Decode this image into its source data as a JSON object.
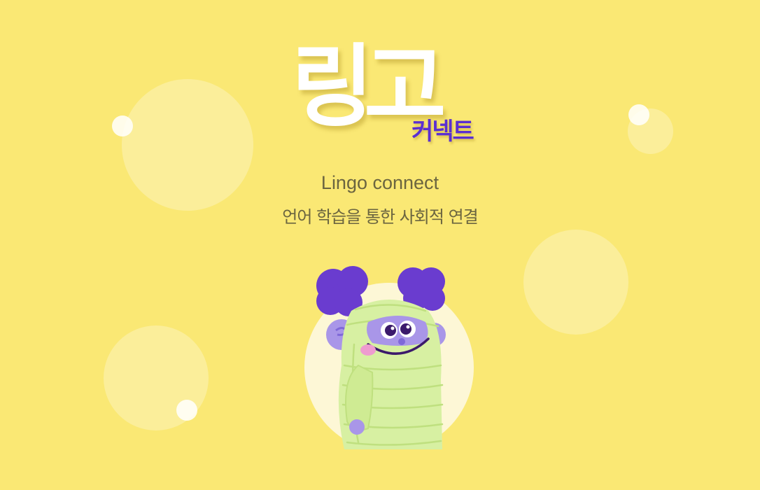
{
  "logo": {
    "main": "링고",
    "sub": "커넥트"
  },
  "app_name": "Lingo connect",
  "tagline": "언어 학습을 통한 사회적 연결",
  "colors": {
    "background": "#fae874",
    "logo_text": "#ffffff",
    "accent_purple": "#5b2fd1",
    "body_text": "#6b6540",
    "mascot_body": "#d7f0a2",
    "mascot_hair": "#6a3ccf"
  },
  "mascot": {
    "icon": "mummy-monster-mascot"
  }
}
